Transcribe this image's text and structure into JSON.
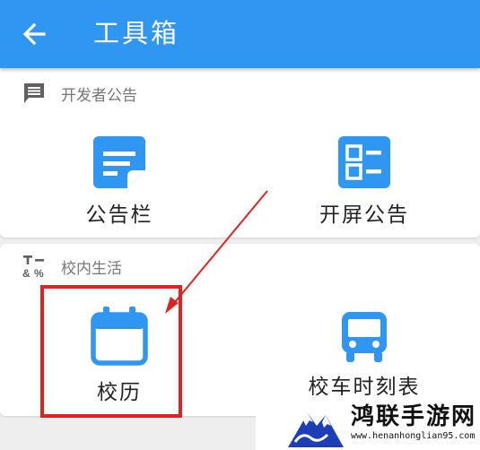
{
  "appbar": {
    "title": "工具箱",
    "back_icon": "arrow-left-icon",
    "color": "#2f97f1"
  },
  "sections": [
    {
      "label": "开发者公告",
      "icon": "message-icon",
      "tiles": [
        {
          "label": "公告栏",
          "icon": "note-icon"
        },
        {
          "label": "开屏公告",
          "icon": "list-icon"
        }
      ]
    },
    {
      "label": "校内生活",
      "icon": "symbols-icon",
      "tiles": [
        {
          "label": "校历",
          "icon": "calendar-icon"
        },
        {
          "label": "校车时刻表",
          "icon": "bus-icon"
        }
      ]
    }
  ],
  "annotation": {
    "color": "#e12222"
  },
  "watermark": {
    "title": "鸿联手游网",
    "url": "www.henanhonglian95.com"
  }
}
